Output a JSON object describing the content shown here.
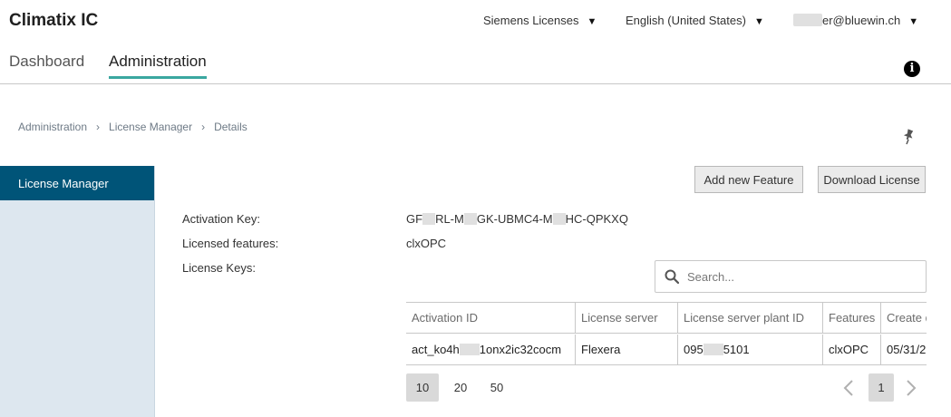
{
  "app": {
    "title": "Climatix IC"
  },
  "header": {
    "org_menu": "Siemens Licenses",
    "lang_menu": "English (United States)",
    "user_menu_suffix": "er@bluewin.ch",
    "caret": "▼",
    "info_glyph": "i"
  },
  "tabs": [
    {
      "label": "Dashboard",
      "active": false
    },
    {
      "label": "Administration",
      "active": true
    }
  ],
  "breadcrumb": {
    "items": [
      "Administration",
      "License Manager",
      "Details"
    ],
    "separator": "›"
  },
  "sidebar": {
    "items": [
      {
        "label": "License Manager",
        "active": true
      }
    ]
  },
  "actions": {
    "add_feature": "Add new Feature",
    "download_license": "Download License"
  },
  "details": {
    "activation_key_label": "Activation Key:",
    "activation_key_parts": [
      "GF",
      "RL-M",
      "GK-UBMC4-M",
      "HC-QPKXQ"
    ],
    "features_label": "Licensed features:",
    "features_value": "clxOPC",
    "keys_label": "License Keys:"
  },
  "search": {
    "placeholder": "Search..."
  },
  "table": {
    "columns": [
      "Activation ID",
      "License server",
      "License server plant ID",
      "Features",
      "Create d"
    ],
    "rows": [
      {
        "activation_id_prefix": "act_ko4h",
        "activation_id_suffix": "1onx2ic32cocm",
        "license_server": "Flexera",
        "plant_id_prefix": "095",
        "plant_id_suffix": "5101",
        "features": "clxOPC",
        "created": "05/31/2"
      }
    ]
  },
  "pagination": {
    "page_sizes": [
      "10",
      "20",
      "50"
    ],
    "selected_page_size": "10",
    "current_page": "1"
  },
  "colors": {
    "accent_tab": "#3aa7a0",
    "sidebar_active": "#005478",
    "sidebar_bg": "#dde7ef"
  }
}
